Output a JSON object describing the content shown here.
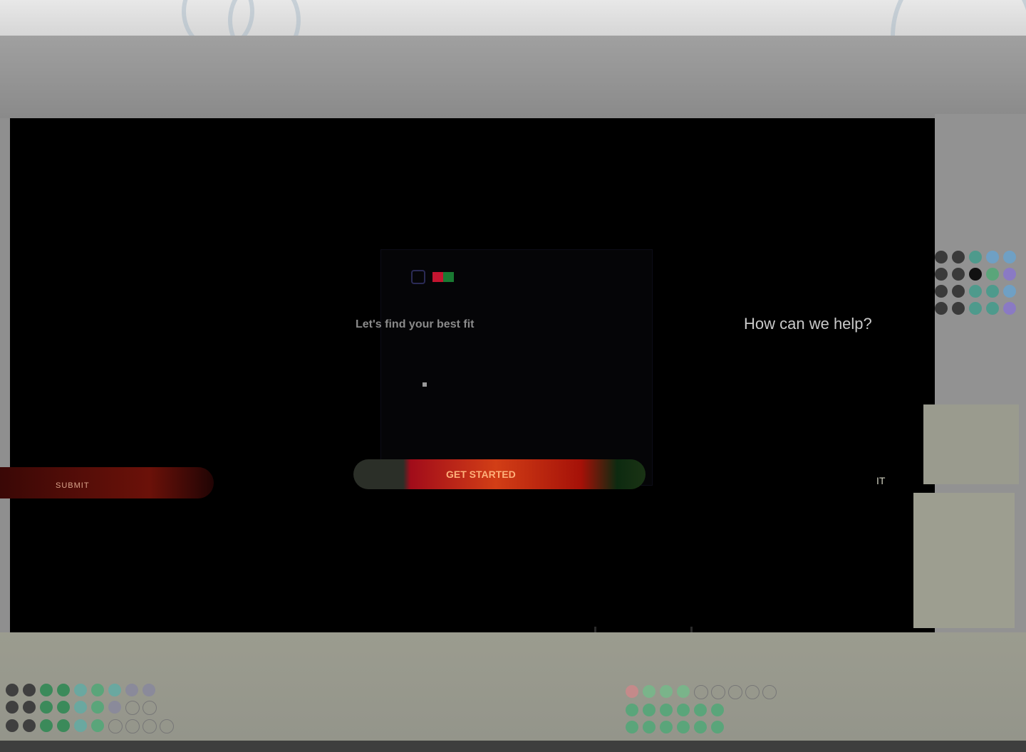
{
  "modal": {
    "title": "Let's find your best fit",
    "subtitle": "",
    "body": ""
  },
  "hero": {
    "question": "How can we help?"
  },
  "buttons": {
    "left_label": "SUBMIT",
    "main_label": "GET STARTED",
    "right_label": "IT"
  },
  "colors": {
    "primary_red": "#c41530",
    "accent_orange": "#d23e16",
    "dark_bg": "#000000"
  }
}
